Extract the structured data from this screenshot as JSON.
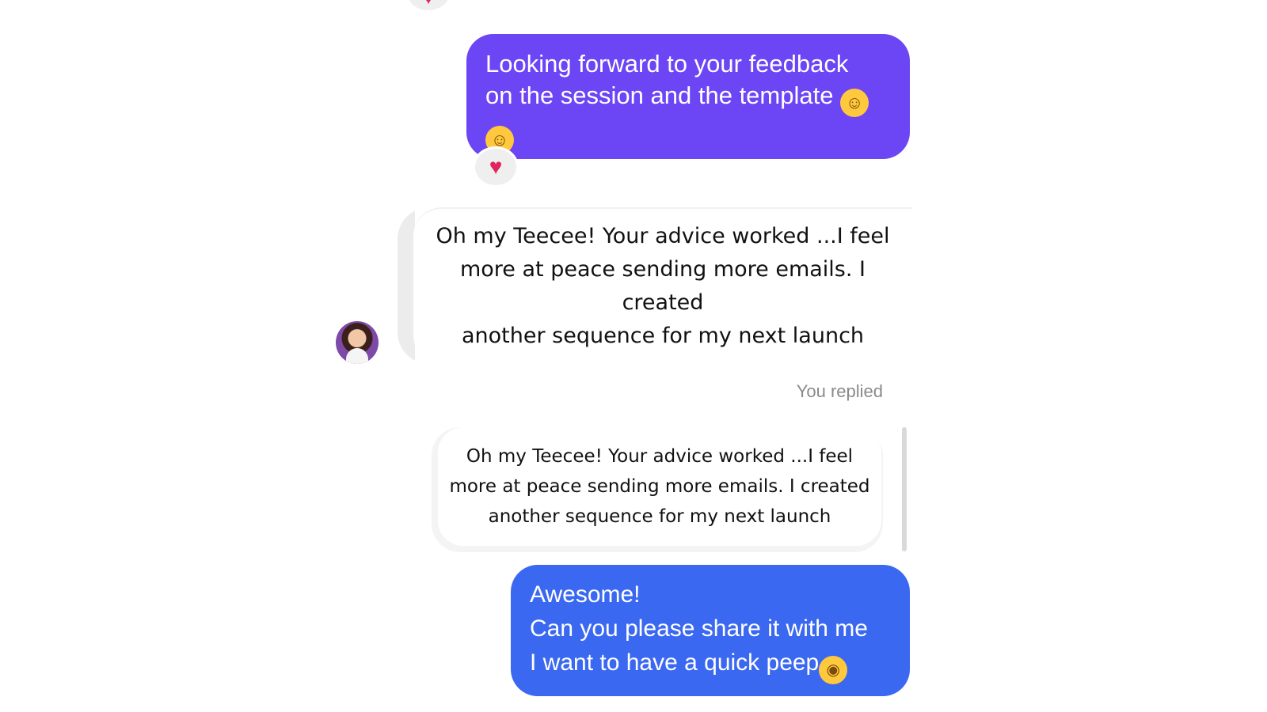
{
  "messages": {
    "top_reaction": "♥",
    "outgoing_1": {
      "line1": "Looking forward to your feedback",
      "line2": "on the session and the template",
      "emoji": "hugging-face-emoji",
      "reaction": "heart"
    },
    "incoming": {
      "line1": "Oh my Teecee! Your advice worked  ...I feel",
      "line2": "more at peace sending more emails. I created",
      "line3": "another sequence for my next launch"
    },
    "reply_label": "You replied",
    "quoted": {
      "line1": "Oh my Teecee! Your advice worked  ...I feel",
      "line2": "more at peace sending more emails. I created",
      "line3": "another sequence for my next launch"
    },
    "outgoing_2": {
      "line1": "Awesome!",
      "line2": "Can you please share it with me",
      "line3": "I want to have a quick peep",
      "emoji": "face-with-hand-over-mouth-emoji"
    }
  },
  "colors": {
    "purple_bubble": "#6c45f5",
    "blue_bubble": "#3a68f0",
    "reaction_heart": "#e0245e",
    "muted_text": "#8a8a8a"
  }
}
